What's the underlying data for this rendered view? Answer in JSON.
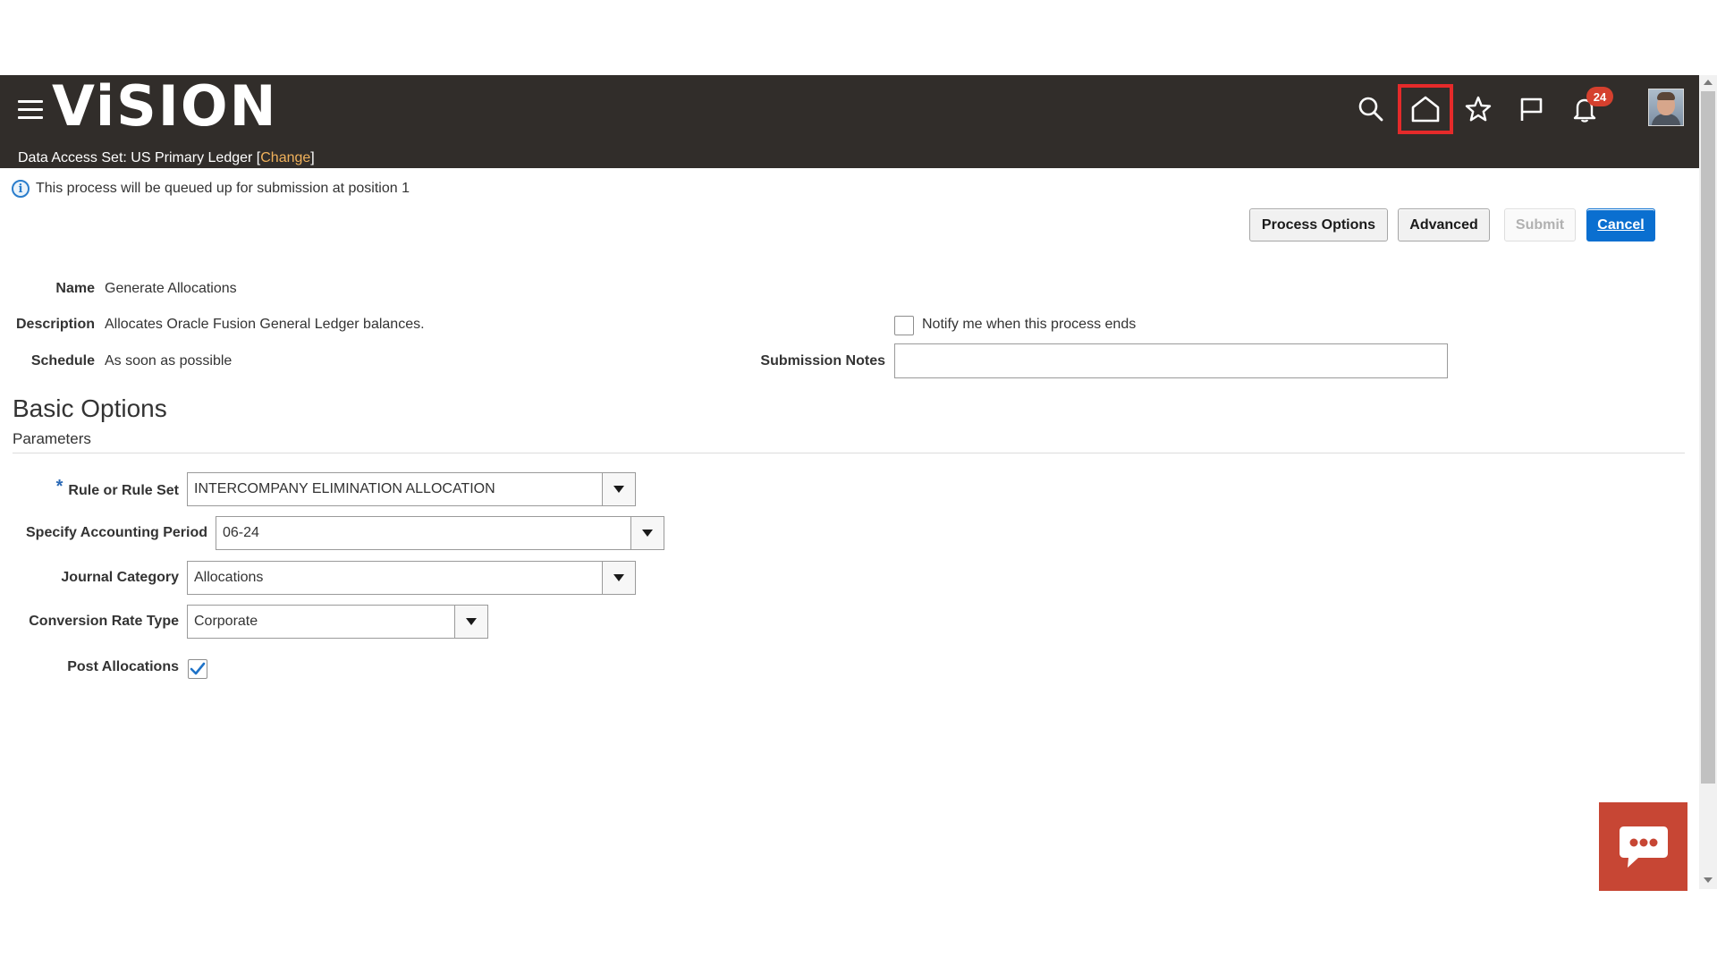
{
  "header": {
    "logo_text": "ViSION",
    "data_access_label": "Data Access Set:",
    "data_access_value": "US Primary Ledger",
    "change_link": "Change",
    "notification_count": "24",
    "icons": [
      "menu-icon",
      "search-icon",
      "home-icon",
      "star-icon",
      "flag-icon",
      "bell-icon"
    ],
    "bg_color": "#312d2a"
  },
  "info": {
    "message": "This process will be queued up for submission at position 1"
  },
  "toolbar": {
    "process_options": "Process Options",
    "advanced": "Advanced",
    "submit": "Submit",
    "cancel": "Cancel"
  },
  "details": {
    "name_label": "Name",
    "name_value": "Generate Allocations",
    "description_label": "Description",
    "description_value": "Allocates Oracle Fusion General Ledger balances.",
    "schedule_label": "Schedule",
    "schedule_value": "As soon as possible",
    "notify_label": "Notify me when this process ends",
    "submission_notes_label": "Submission Notes",
    "submission_notes_value": ""
  },
  "basic_options": {
    "title": "Basic Options",
    "subtitle": "Parameters",
    "rule_label": "Rule or Rule Set",
    "rule_value": "INTERCOMPANY ELIMINATION ALLOCATION",
    "period_label": "Specify Accounting Period",
    "period_value": "06-24",
    "category_label": "Journal Category",
    "category_value": "Allocations",
    "rate_type_label": "Conversion Rate Type",
    "rate_type_value": "Corporate",
    "post_label": "Post Allocations",
    "post_checked": true
  },
  "colors": {
    "primary_button": "#0a6fd0",
    "highlight": "#e52a2a",
    "chat": "#c74634"
  }
}
